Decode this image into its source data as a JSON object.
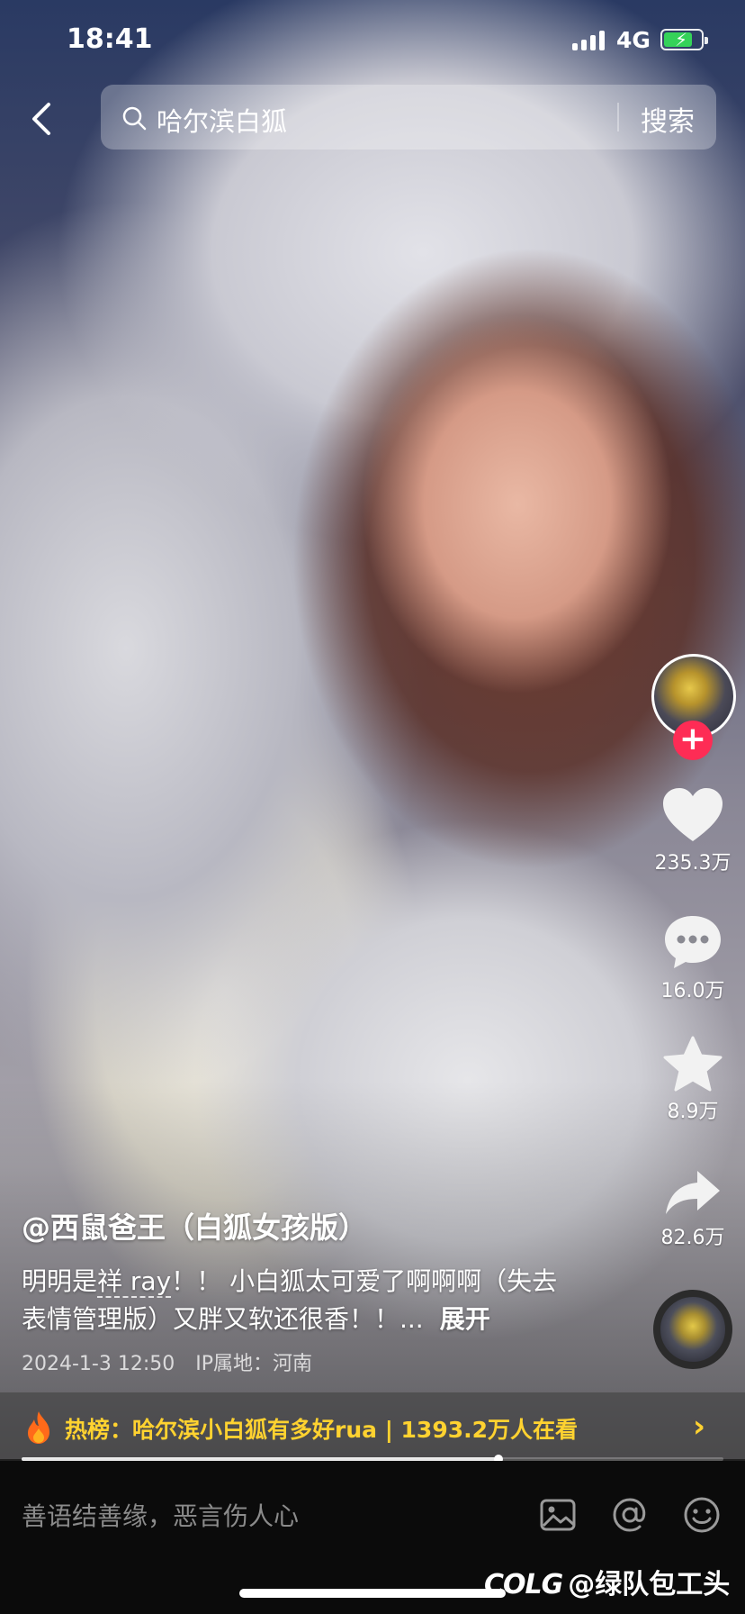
{
  "status_bar": {
    "time": "18:41",
    "network": "4G"
  },
  "search": {
    "query": "哈尔滨白狐",
    "button_label": "搜索"
  },
  "actions": {
    "likes": "235.3万",
    "comments": "16.0万",
    "favorites": "8.9万",
    "shares": "82.6万"
  },
  "post": {
    "author": "@西鼠爸王（白狐女孩版）",
    "desc_prefix": "明明是",
    "desc_highlight": "祥 ray",
    "desc_rest": "！！ 小白狐太可爱了啊啊啊（失去表情管理版）又胖又软还很香！！...",
    "more_label": "展开",
    "datetime": "2024-1-3 12:50",
    "ip_location": "IP属地：河南"
  },
  "hot_banner": {
    "text": "热榜：哈尔滨小白狐有多好rua | 1393.2万人在看",
    "chevron": "›"
  },
  "playback": {
    "progress": 0.68
  },
  "comment_bar": {
    "placeholder": "善语结善缘，恶言伤人心"
  },
  "watermark": {
    "logo": "COLG",
    "text": "@绿队包工头"
  },
  "colors": {
    "accent_red": "#fe2c55",
    "hot_yellow": "#ffd230",
    "battery_green": "#35d259"
  }
}
